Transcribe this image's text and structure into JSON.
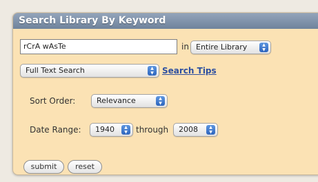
{
  "panel": {
    "title": "Search Library By Keyword"
  },
  "search": {
    "query_value": "rCrA wAsTe",
    "in_label": "in",
    "scope": {
      "selected": "Entire Library"
    }
  },
  "search_type": {
    "selected": "Full Text Search"
  },
  "search_tips_link": "Search Tips",
  "sort": {
    "label": "Sort Order:",
    "selected": "Relevance"
  },
  "date_range": {
    "label": "Date Range:",
    "from": "1940",
    "through_label": "through",
    "to": "2008"
  },
  "buttons": {
    "submit": "submit",
    "reset": "reset"
  },
  "icons": {
    "select_arrows": "updown-arrows-icon"
  },
  "colors": {
    "title_bar": "#7f93ac",
    "panel_bg": "#fbe2b4",
    "link": "#2d4fa0",
    "select_arrows": "#3a73cc"
  }
}
